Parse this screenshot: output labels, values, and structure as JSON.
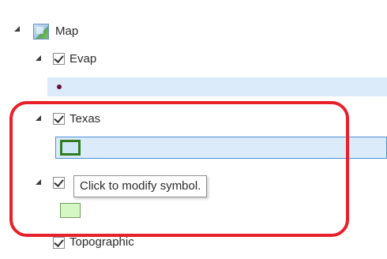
{
  "contents": {
    "map": {
      "label": "Map",
      "icon": "map-icon",
      "expanded": true
    },
    "layers": [
      {
        "label": "Evap",
        "checked": true,
        "expanded": true,
        "symbol": "point",
        "symbol_color": "#6a1035"
      },
      {
        "label": "Texas",
        "checked": true,
        "expanded": true,
        "symbol": "polygon",
        "symbol_fill": "#cfe6f7",
        "symbol_outline": "#2f7d1e",
        "selected": true
      },
      {
        "label": "",
        "checked": true,
        "expanded": true,
        "symbol": "polygon",
        "symbol_fill": "#d4f7c4",
        "symbol_outline": "#6b9f5a"
      },
      {
        "label": "Topographic",
        "checked": true,
        "expanded": false
      }
    ]
  },
  "tooltip": {
    "text": "Click to modify symbol."
  },
  "colors": {
    "highlight": "#dcebfa",
    "selection_border": "#4a90d9",
    "annotation": "#e8202a"
  }
}
